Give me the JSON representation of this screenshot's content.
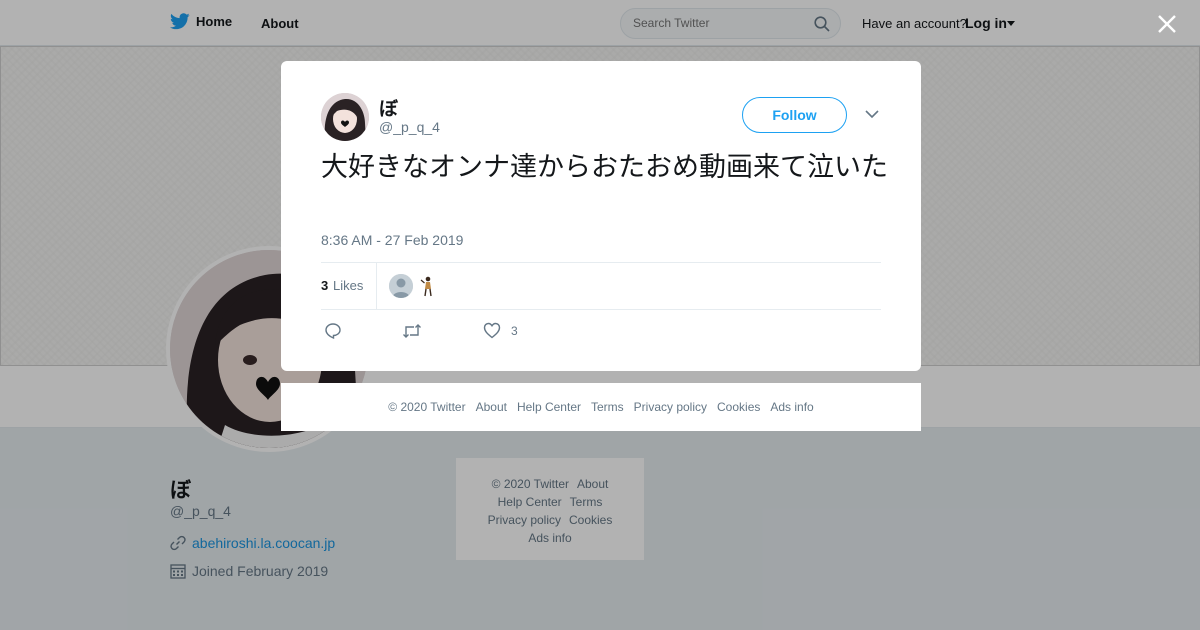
{
  "topbar": {
    "home_label": "Home",
    "about_label": "About",
    "search_placeholder": "Search Twitter",
    "account_question": "Have an account?",
    "login_label": "Log in"
  },
  "profile": {
    "name": "ぼ",
    "handle": "@_p_q_4",
    "website": "abehiroshi.la.coocan.jp",
    "joined": "Joined February 2019"
  },
  "side_footer": {
    "copyright": "© 2020 Twitter",
    "about": "About",
    "help": "Help Center",
    "terms": "Terms",
    "privacy": "Privacy policy",
    "cookies": "Cookies",
    "ads": "Ads info"
  },
  "tweet": {
    "name": "ぼ",
    "handle": "@_p_q_4",
    "follow_label": "Follow",
    "text": "大好きなオンナ達からおたおめ動画来て泣いた",
    "timestamp": "8:36 AM - 27 Feb 2019",
    "likes_count": "3",
    "likes_label": "Likes",
    "like_action_count": "3"
  },
  "modal_footer": {
    "copyright": "© 2020 Twitter",
    "about": "About",
    "help": "Help Center",
    "terms": "Terms",
    "privacy": "Privacy policy",
    "cookies": "Cookies",
    "ads": "Ads info"
  },
  "colors": {
    "brand": "#1da1f2",
    "link": "#1b95e0",
    "muted": "#657786"
  },
  "icons": [
    "twitter-bird-icon",
    "search-icon",
    "caret-down-icon",
    "close-icon",
    "link-icon",
    "calendar-icon",
    "chevron-down-icon",
    "reply-icon",
    "retweet-icon",
    "heart-icon"
  ]
}
